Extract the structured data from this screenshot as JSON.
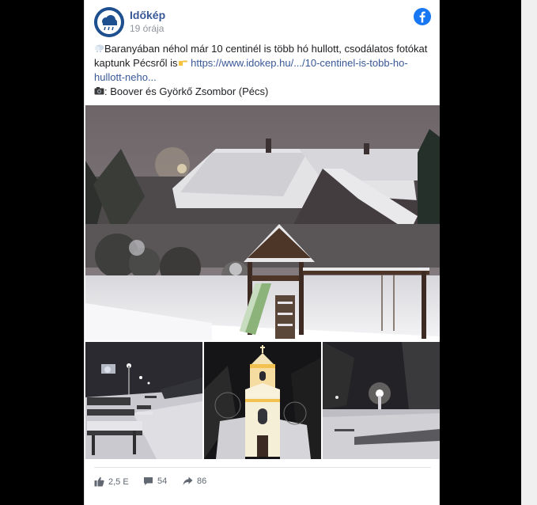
{
  "post": {
    "page_name": "Időkép",
    "timestamp": "19 órája",
    "text_line1": "Baranyában néhol már 10 centinél is több hó hullott, csodálatos fotókat kaptunk Pécsről is",
    "link_text": "https://www.idokep.hu/.../10-centinel-is-tobb-ho-hullott-neho...",
    "credit": ": Boover és Györkő Zsombor (Pécs)"
  },
  "icons": {
    "snow_cloud": "snow-cloud-icon",
    "pointing_hand": "pointing-hand-icon",
    "camera": "camera-icon",
    "facebook": "facebook-icon",
    "like": "like-icon",
    "comment": "comment-icon",
    "share": "share-icon"
  },
  "stats": {
    "likes": "2,5 E",
    "comments": "54",
    "shares": "86"
  },
  "colors": {
    "brand": "#1877f2",
    "link": "#385898",
    "avatar": "#1e4f8f",
    "muted": "#606770"
  }
}
